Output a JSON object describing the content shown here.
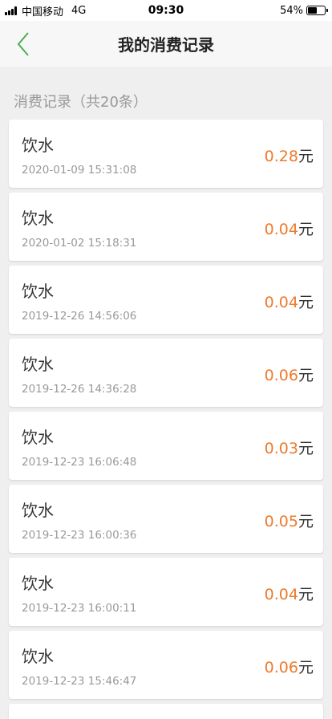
{
  "status_bar": {
    "carrier": "中国移动",
    "network": "4G",
    "time": "09:30",
    "battery": "54%",
    "battery_level": 0.54
  },
  "nav": {
    "title": "我的消费记录",
    "back_icon": "chevron-left-icon",
    "accent_color": "#4caf50"
  },
  "section": {
    "header": "消费记录（共20条）"
  },
  "colors": {
    "amount": "#ee7a2c",
    "background": "#efefef"
  },
  "records": [
    {
      "title": "饮水",
      "time": "2020-01-09 15:31:08",
      "amount": "0.28",
      "unit": "元"
    },
    {
      "title": "饮水",
      "time": "2020-01-02 15:18:31",
      "amount": "0.04",
      "unit": "元"
    },
    {
      "title": "饮水",
      "time": "2019-12-26 14:56:06",
      "amount": "0.04",
      "unit": "元"
    },
    {
      "title": "饮水",
      "time": "2019-12-26 14:36:28",
      "amount": "0.06",
      "unit": "元"
    },
    {
      "title": "饮水",
      "time": "2019-12-23 16:06:48",
      "amount": "0.03",
      "unit": "元"
    },
    {
      "title": "饮水",
      "time": "2019-12-23 16:00:36",
      "amount": "0.05",
      "unit": "元"
    },
    {
      "title": "饮水",
      "time": "2019-12-23 16:00:11",
      "amount": "0.04",
      "unit": "元"
    },
    {
      "title": "饮水",
      "time": "2019-12-23 15:46:47",
      "amount": "0.06",
      "unit": "元"
    }
  ]
}
